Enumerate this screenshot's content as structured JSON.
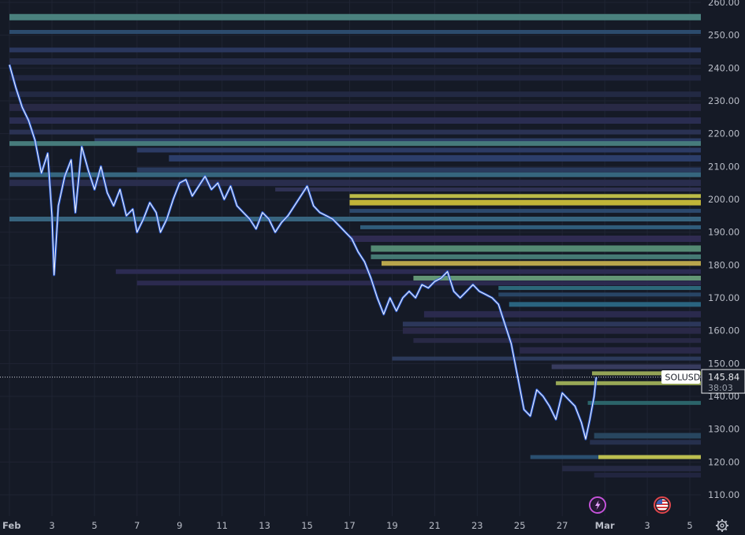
{
  "chart_data": {
    "type": "line",
    "symbol": "SOLUSD",
    "last_price": 145.84,
    "last_price_label": "145.84",
    "countdown": "38:03",
    "ylim": [
      105,
      262
    ],
    "y_ticks": [
      110,
      120,
      130,
      140,
      150,
      160,
      170,
      180,
      190,
      200,
      210,
      220,
      230,
      240,
      250,
      260
    ],
    "y_tick_labels": [
      "110.00",
      "120.00",
      "130.00",
      "140.00",
      "150.00",
      "160.00",
      "170.00",
      "180.00",
      "190.00",
      "200.00",
      "210.00",
      "220.00",
      "230.00",
      "240.00",
      "250.00",
      "260.00"
    ],
    "x_ticks": [
      {
        "label": "Feb",
        "day": 1
      },
      {
        "label": "3",
        "day": 3
      },
      {
        "label": "5",
        "day": 5
      },
      {
        "label": "7",
        "day": 7
      },
      {
        "label": "9",
        "day": 9
      },
      {
        "label": "11",
        "day": 11
      },
      {
        "label": "13",
        "day": 13
      },
      {
        "label": "15",
        "day": 15
      },
      {
        "label": "17",
        "day": 17
      },
      {
        "label": "19",
        "day": 19
      },
      {
        "label": "21",
        "day": 21
      },
      {
        "label": "23",
        "day": 23
      },
      {
        "label": "25",
        "day": 25
      },
      {
        "label": "27",
        "day": 27
      },
      {
        "label": "Mar",
        "day": 29
      },
      {
        "label": "3",
        "day": 31
      },
      {
        "label": "5",
        "day": 33
      }
    ],
    "xlim": [
      1,
      33
    ],
    "price_series": [
      [
        1.0,
        241
      ],
      [
        1.3,
        234
      ],
      [
        1.6,
        228
      ],
      [
        1.9,
        224
      ],
      [
        2.2,
        218
      ],
      [
        2.5,
        208
      ],
      [
        2.8,
        214
      ],
      [
        3.0,
        195
      ],
      [
        3.1,
        177
      ],
      [
        3.3,
        198
      ],
      [
        3.6,
        207
      ],
      [
        3.9,
        212
      ],
      [
        4.1,
        196
      ],
      [
        4.4,
        216
      ],
      [
        4.7,
        209
      ],
      [
        5.0,
        203
      ],
      [
        5.3,
        210
      ],
      [
        5.6,
        202
      ],
      [
        5.9,
        198
      ],
      [
        6.2,
        203
      ],
      [
        6.5,
        195
      ],
      [
        6.8,
        197
      ],
      [
        7.0,
        190
      ],
      [
        7.3,
        194
      ],
      [
        7.6,
        199
      ],
      [
        7.9,
        196
      ],
      [
        8.1,
        190
      ],
      [
        8.4,
        194
      ],
      [
        8.7,
        200
      ],
      [
        9.0,
        205
      ],
      [
        9.3,
        206
      ],
      [
        9.6,
        201
      ],
      [
        9.9,
        204
      ],
      [
        10.2,
        207
      ],
      [
        10.5,
        203
      ],
      [
        10.8,
        205
      ],
      [
        11.1,
        200
      ],
      [
        11.4,
        204
      ],
      [
        11.7,
        198
      ],
      [
        12.0,
        196
      ],
      [
        12.3,
        194
      ],
      [
        12.6,
        191
      ],
      [
        12.9,
        196
      ],
      [
        13.2,
        194
      ],
      [
        13.5,
        190
      ],
      [
        13.8,
        193
      ],
      [
        14.1,
        195
      ],
      [
        14.4,
        198
      ],
      [
        14.7,
        201
      ],
      [
        15.0,
        204
      ],
      [
        15.3,
        198
      ],
      [
        15.6,
        196
      ],
      [
        15.9,
        195
      ],
      [
        16.2,
        194
      ],
      [
        16.5,
        192
      ],
      [
        16.8,
        190
      ],
      [
        17.1,
        188
      ],
      [
        17.4,
        184
      ],
      [
        17.7,
        181
      ],
      [
        18.0,
        176
      ],
      [
        18.3,
        170
      ],
      [
        18.6,
        165
      ],
      [
        18.9,
        170
      ],
      [
        19.2,
        166
      ],
      [
        19.5,
        170
      ],
      [
        19.8,
        172
      ],
      [
        20.1,
        170
      ],
      [
        20.4,
        174
      ],
      [
        20.7,
        173
      ],
      [
        21.0,
        175
      ],
      [
        21.3,
        176
      ],
      [
        21.6,
        178
      ],
      [
        21.9,
        172
      ],
      [
        22.2,
        170
      ],
      [
        22.5,
        172
      ],
      [
        22.8,
        174
      ],
      [
        23.1,
        172
      ],
      [
        23.4,
        171
      ],
      [
        23.7,
        170
      ],
      [
        24.0,
        168
      ],
      [
        24.3,
        162
      ],
      [
        24.6,
        156
      ],
      [
        24.9,
        146
      ],
      [
        25.2,
        136
      ],
      [
        25.5,
        134
      ],
      [
        25.8,
        142
      ],
      [
        26.1,
        140
      ],
      [
        26.4,
        137
      ],
      [
        26.7,
        133
      ],
      [
        27.0,
        141
      ],
      [
        27.3,
        139
      ],
      [
        27.6,
        137
      ],
      [
        27.9,
        132
      ],
      [
        28.1,
        127
      ],
      [
        28.3,
        133
      ],
      [
        28.5,
        140
      ],
      [
        28.6,
        145.84
      ]
    ],
    "liquidity_levels": [
      {
        "price": 255.5,
        "x_start_day": 1.0,
        "color": "#4f8a86",
        "h": 8
      },
      {
        "price": 251.0,
        "x_start_day": 1.0,
        "color": "#2f4f73",
        "h": 5
      },
      {
        "price": 245.5,
        "x_start_day": 1.0,
        "color": "#2c3a62",
        "h": 6
      },
      {
        "price": 242.0,
        "x_start_day": 1.0,
        "color": "#262c4a",
        "h": 8
      },
      {
        "price": 237.0,
        "x_start_day": 1.0,
        "color": "#232742",
        "h": 7
      },
      {
        "price": 232.0,
        "x_start_day": 1.0,
        "color": "#242a45",
        "h": 7
      },
      {
        "price": 228.0,
        "x_start_day": 1.0,
        "color": "#2a2a48",
        "h": 9
      },
      {
        "price": 224.0,
        "x_start_day": 1.0,
        "color": "#2d2f55",
        "h": 8
      },
      {
        "price": 220.5,
        "x_start_day": 1.0,
        "color": "#2d3457",
        "h": 6
      },
      {
        "price": 218.0,
        "x_start_day": 5.0,
        "color": "#2e3f69",
        "h": 5
      },
      {
        "price": 217.0,
        "x_start_day": 1.0,
        "color": "#4b8382",
        "h": 6
      },
      {
        "price": 215.0,
        "x_start_day": 7.0,
        "color": "#2f3e69",
        "h": 6
      },
      {
        "price": 212.5,
        "x_start_day": 8.5,
        "color": "#2f4170",
        "h": 8
      },
      {
        "price": 209.0,
        "x_start_day": 7.0,
        "color": "#2b3d62",
        "h": 6
      },
      {
        "price": 207.5,
        "x_start_day": 1.0,
        "color": "#3a6d86",
        "h": 6
      },
      {
        "price": 205.0,
        "x_start_day": 1.0,
        "color": "#2b2f50",
        "h": 8
      },
      {
        "price": 203.0,
        "x_start_day": 13.5,
        "color": "#323458",
        "h": 5
      },
      {
        "price": 201.0,
        "x_start_day": 17.0,
        "color": "#cbc94a",
        "h": 5
      },
      {
        "price": 199.0,
        "x_start_day": 17.0,
        "color": "#d0c23a",
        "h": 7
      },
      {
        "price": 196.5,
        "x_start_day": 17.0,
        "color": "#2f4d73",
        "h": 5
      },
      {
        "price": 194.0,
        "x_start_day": 1.0,
        "color": "#3b6a85",
        "h": 6
      },
      {
        "price": 191.5,
        "x_start_day": 17.5,
        "color": "#336282",
        "h": 5
      },
      {
        "price": 188.0,
        "x_start_day": 17.0,
        "color": "#322c55",
        "h": 8
      },
      {
        "price": 185.0,
        "x_start_day": 18.0,
        "color": "#5a927a",
        "h": 8
      },
      {
        "price": 182.5,
        "x_start_day": 18.0,
        "color": "#4a817a",
        "h": 6
      },
      {
        "price": 180.5,
        "x_start_day": 18.5,
        "color": "#c8b24f",
        "h": 6
      },
      {
        "price": 178.0,
        "x_start_day": 6.0,
        "color": "#2f2d56",
        "h": 6
      },
      {
        "price": 176.0,
        "x_start_day": 20.0,
        "color": "#6aa07c",
        "h": 6
      },
      {
        "price": 174.5,
        "x_start_day": 7.0,
        "color": "#2e2b52",
        "h": 6
      },
      {
        "price": 173.0,
        "x_start_day": 24.0,
        "color": "#2f6e80",
        "h": 5
      },
      {
        "price": 171.0,
        "x_start_day": 24.0,
        "color": "#2a496a",
        "h": 5
      },
      {
        "price": 168.0,
        "x_start_day": 24.5,
        "color": "#2d6a88",
        "h": 6
      },
      {
        "price": 165.0,
        "x_start_day": 20.5,
        "color": "#2d2b50",
        "h": 8
      },
      {
        "price": 162.0,
        "x_start_day": 19.5,
        "color": "#2f3a5e",
        "h": 6
      },
      {
        "price": 160.0,
        "x_start_day": 19.5,
        "color": "#2c2a4a",
        "h": 8
      },
      {
        "price": 157.0,
        "x_start_day": 20.0,
        "color": "#2a2a48",
        "h": 6
      },
      {
        "price": 154.0,
        "x_start_day": 25.0,
        "color": "#2c2a4c",
        "h": 8
      },
      {
        "price": 151.5,
        "x_start_day": 19.0,
        "color": "#2f3d60",
        "h": 5
      },
      {
        "price": 149.0,
        "x_start_day": 26.5,
        "color": "#3b3e63",
        "h": 6
      },
      {
        "price": 147.0,
        "x_start_day": 28.4,
        "color": "#9fb05a",
        "h": 5
      },
      {
        "price": 144.0,
        "x_start_day": 26.7,
        "color": "#a4b45a",
        "h": 5
      },
      {
        "price": 138.0,
        "x_start_day": 28.2,
        "color": "#2e6a70",
        "h": 5
      },
      {
        "price": 128.0,
        "x_start_day": 28.5,
        "color": "#2a4a64",
        "h": 7
      },
      {
        "price": 126.0,
        "x_start_day": 28.3,
        "color": "#283250",
        "h": 6
      },
      {
        "price": 121.5,
        "x_start_day": 25.5,
        "color": "#2c5476",
        "h": 5
      },
      {
        "price": 121.5,
        "x_start_day": 28.7,
        "color": "#c9c84c",
        "h": 5
      },
      {
        "price": 118.0,
        "x_start_day": 27.0,
        "color": "#272a45",
        "h": 7
      },
      {
        "price": 116.0,
        "x_start_day": 28.5,
        "color": "#232641",
        "h": 6
      }
    ]
  }
}
